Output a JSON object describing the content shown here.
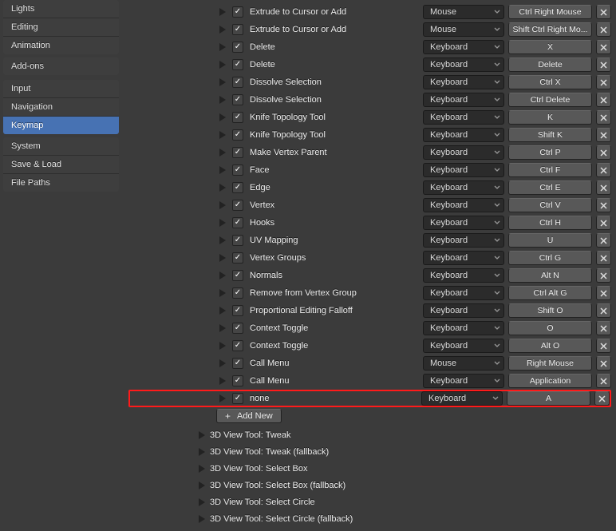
{
  "sidebar": {
    "group1": [
      "Lights",
      "Editing",
      "Animation"
    ],
    "addons": "Add-ons",
    "group2": [
      "Input",
      "Navigation",
      "Keymap"
    ],
    "group3": [
      "System",
      "Save & Load",
      "File Paths"
    ],
    "active": "Keymap"
  },
  "rows": [
    {
      "name": "Extrude to Cursor or Add",
      "device": "Mouse",
      "shortcut": "Ctrl Right Mouse"
    },
    {
      "name": "Extrude to Cursor or Add",
      "device": "Mouse",
      "shortcut": "Shift Ctrl Right Mo..."
    },
    {
      "name": "Delete",
      "device": "Keyboard",
      "shortcut": "X"
    },
    {
      "name": "Delete",
      "device": "Keyboard",
      "shortcut": "Delete"
    },
    {
      "name": "Dissolve Selection",
      "device": "Keyboard",
      "shortcut": "Ctrl X"
    },
    {
      "name": "Dissolve Selection",
      "device": "Keyboard",
      "shortcut": "Ctrl Delete"
    },
    {
      "name": "Knife Topology Tool",
      "device": "Keyboard",
      "shortcut": "K"
    },
    {
      "name": "Knife Topology Tool",
      "device": "Keyboard",
      "shortcut": "Shift K"
    },
    {
      "name": "Make Vertex Parent",
      "device": "Keyboard",
      "shortcut": "Ctrl P"
    },
    {
      "name": "Face",
      "device": "Keyboard",
      "shortcut": "Ctrl F"
    },
    {
      "name": "Edge",
      "device": "Keyboard",
      "shortcut": "Ctrl E"
    },
    {
      "name": "Vertex",
      "device": "Keyboard",
      "shortcut": "Ctrl V"
    },
    {
      "name": "Hooks",
      "device": "Keyboard",
      "shortcut": "Ctrl H"
    },
    {
      "name": "UV Mapping",
      "device": "Keyboard",
      "shortcut": "U"
    },
    {
      "name": "Vertex Groups",
      "device": "Keyboard",
      "shortcut": "Ctrl G"
    },
    {
      "name": "Normals",
      "device": "Keyboard",
      "shortcut": "Alt N"
    },
    {
      "name": "Remove from Vertex Group",
      "device": "Keyboard",
      "shortcut": "Ctrl Alt G"
    },
    {
      "name": "Proportional Editing Falloff",
      "device": "Keyboard",
      "shortcut": "Shift O"
    },
    {
      "name": "Context Toggle",
      "device": "Keyboard",
      "shortcut": "O"
    },
    {
      "name": "Context Toggle",
      "device": "Keyboard",
      "shortcut": "Alt O"
    },
    {
      "name": "Call Menu",
      "device": "Mouse",
      "shortcut": "Right Mouse"
    },
    {
      "name": "Call Menu",
      "device": "Keyboard",
      "shortcut": "Application"
    },
    {
      "name": "none",
      "device": "Keyboard",
      "shortcut": "A",
      "highlight": true
    }
  ],
  "addnew_label": "Add New",
  "sections": [
    "3D View Tool: Tweak",
    "3D View Tool: Tweak (fallback)",
    "3D View Tool: Select Box",
    "3D View Tool: Select Box (fallback)",
    "3D View Tool: Select Circle",
    "3D View Tool: Select Circle (fallback)"
  ]
}
